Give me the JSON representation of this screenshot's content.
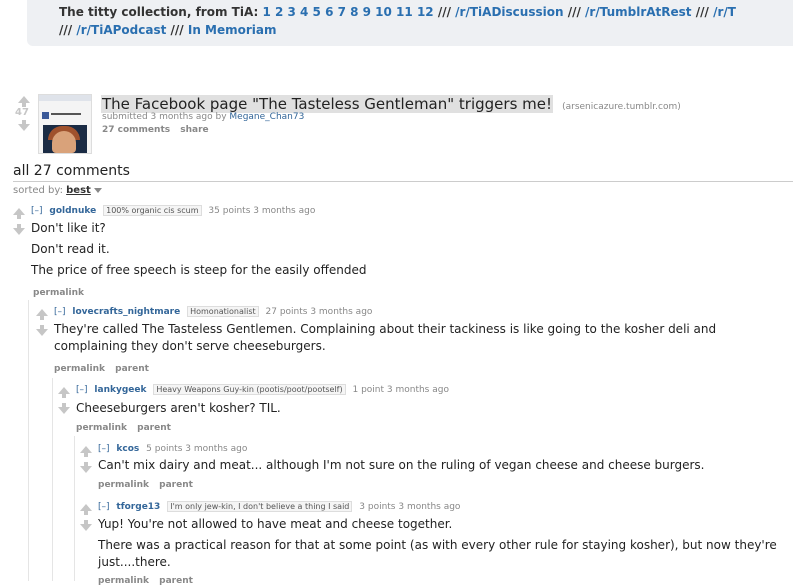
{
  "banner": {
    "prefix": "The titty collection, from TiA:",
    "numbers": "1 2 3 4 5 6 7 8 9 10 11 12",
    "sep": "///",
    "links_line1": [
      "/r/TiADiscussion",
      "/r/TumblrAtRest",
      "/r/T"
    ],
    "links_line2": [
      "/r/TiAPodcast",
      "In Memoriam"
    ]
  },
  "post": {
    "score": "47",
    "title": "The Facebook page \"The Tasteless Gentleman\" triggers me!",
    "domain": "(arsenicazure.tumblr.com)",
    "submitted": "submitted 3 months ago by",
    "author": "Megane_Chan73",
    "comments_label": "27 comments",
    "share_label": "share",
    "thumb_text": "THE LOOK OF LOVE"
  },
  "comments_header": "all 27 comments",
  "sort": {
    "label": "sorted by:",
    "value": "best"
  },
  "comments": [
    {
      "expand": "[–]",
      "author": "goldnuke",
      "flair": "100% organic cis scum",
      "meta": "35 points 3 months ago",
      "lines": [
        "Don't like it?",
        "Don't read it.",
        "The price of free speech is steep for the easily offended"
      ],
      "buttons": [
        "permalink"
      ]
    },
    {
      "expand": "[–]",
      "author": "lovecrafts_nightmare",
      "flair": "Homonationalist",
      "meta": "27 points 3 months ago",
      "lines": [
        "They're called The Tasteless Gentlemen. Complaining about their tackiness is like going to the kosher deli and complaining they don't serve cheeseburgers."
      ],
      "buttons": [
        "permalink",
        "parent"
      ]
    },
    {
      "expand": "[–]",
      "author": "lankygeek",
      "flair": "Heavy Weapons Guy-kin (pootis/poot/pootself)",
      "meta": "1 point 3 months ago",
      "lines": [
        "Cheeseburgers aren't kosher? TIL."
      ],
      "buttons": [
        "permalink",
        "parent"
      ]
    },
    {
      "expand": "[–]",
      "author": "kcos",
      "flair": "",
      "meta": "5 points 3 months ago",
      "lines": [
        "Can't mix dairy and meat... although I'm not sure on the ruling of vegan cheese and cheese burgers."
      ],
      "buttons": [
        "permalink",
        "parent"
      ]
    },
    {
      "expand": "[–]",
      "author": "tforge13",
      "flair": "I'm only jew-kin, I don't believe a thing I said",
      "meta": "3 points 3 months ago",
      "lines": [
        "Yup! You're not allowed to have meat and cheese together.",
        "There was a practical reason for that at some point (as with every other rule for staying kosher), but now they're just....there."
      ],
      "buttons": [
        "permalink",
        "parent"
      ]
    }
  ]
}
